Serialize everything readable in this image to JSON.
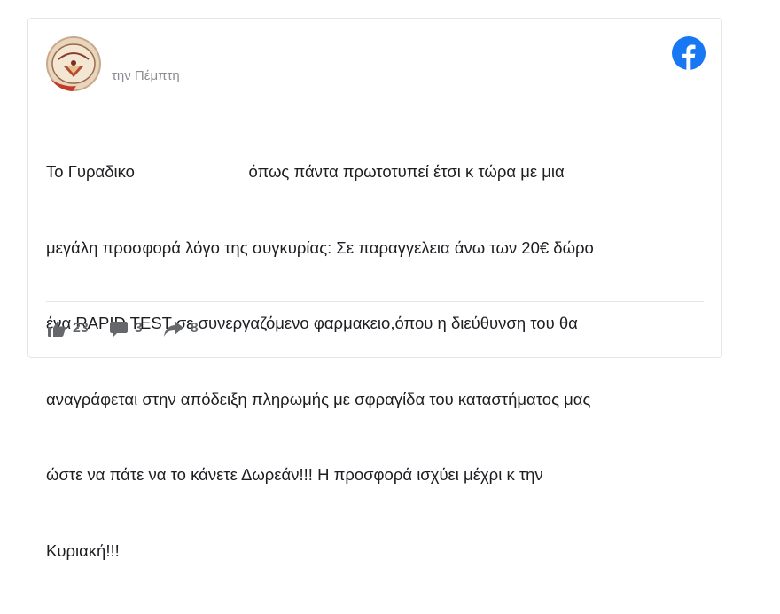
{
  "post": {
    "timestamp": "την Πέμπτη",
    "avatar_icon": "page-logo-avatar",
    "brand_icon": "facebook-icon",
    "text_lines": [
      "Το Γυραδικο                         όπως πάντα πρωτοτυπεί έτσι κ τώρα με μια",
      "μεγάλη προσφορά λόγο της συγκυρίας: Σε παραγγελεια άνω των 20€ δώρο",
      "ένα RAPID TEST σε συνεργαζόμενο φαρμακειο,όπου η διεύθυνση του θα",
      "αναγράφεται στην απόδειξη πληρωμής με σφραγίδα του καταστήματος μας",
      "ώστε να πάτε να το κάνετε Δωρεάν!!! Η προσφορά ισχύει μέχρι κ την",
      "Κυριακή!!!"
    ]
  },
  "actions": {
    "likes": "23",
    "comments": "3",
    "shares": "8"
  },
  "colors": {
    "facebook_blue": "#1877f2",
    "icon_gray": "#65676b",
    "text": "#1c1e21",
    "timestamp": "#8a8d91"
  }
}
